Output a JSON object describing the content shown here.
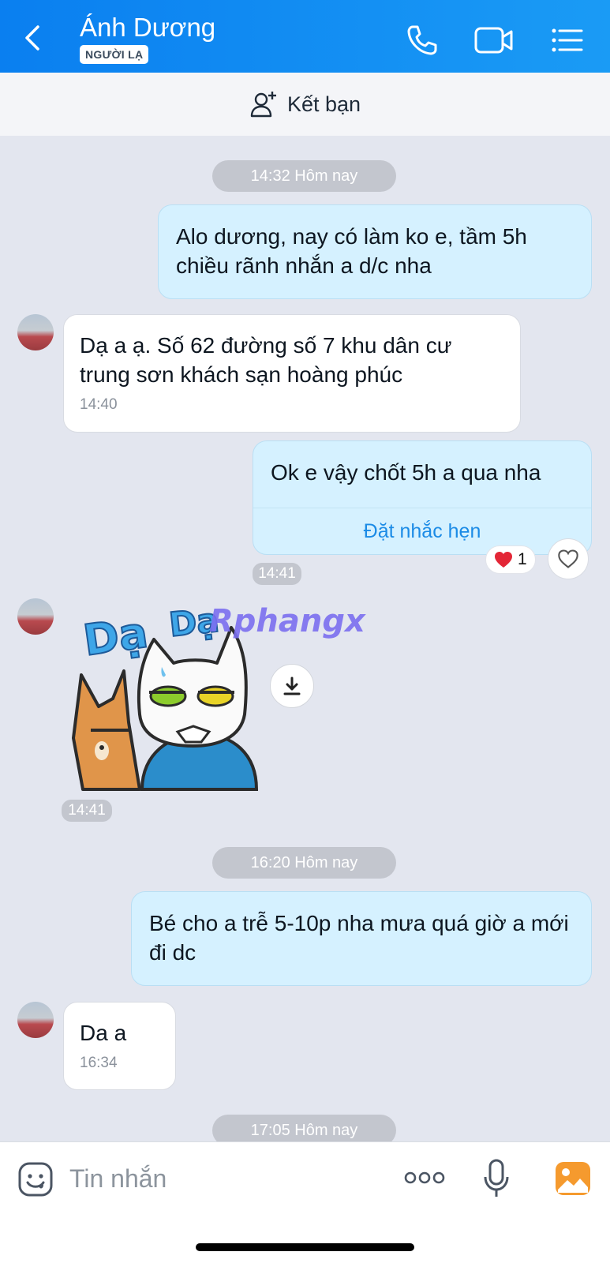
{
  "header": {
    "title": "Ánh Dương",
    "badge": "NGƯỜI LẠ",
    "bg_color": "#0a7ff0"
  },
  "friend_bar": {
    "label": "Kết bạn"
  },
  "messages": {
    "chip1": "14:32 Hôm nay",
    "m1": {
      "text": "Alo dương, nay có làm ko e, tầm 5h chiều rãnh nhắn a d/c nha"
    },
    "m2": {
      "text": "Dạ a ạ.  Số 62 đường số 7 khu dân cư trung sơn khách sạn hoàng phúc",
      "time": "14:40"
    },
    "m3": {
      "text": "Ok e vậy chốt 5h a qua nha",
      "action": "Đặt nhắc hẹn",
      "time": "14:41",
      "reaction_count": "1"
    },
    "sticker": {
      "label": "Dạ. Dạ",
      "watermark": "Rphangx",
      "time": "14:41"
    },
    "chip2": "16:20 Hôm nay",
    "m4": {
      "text": "Bé cho a trễ 5-10p nha mưa quá giờ a mới đi dc"
    },
    "m5": {
      "text": "Da a",
      "time": "16:34"
    },
    "chip3": "17:05 Hôm nay"
  },
  "composer": {
    "placeholder": "Tin nhắn"
  },
  "icons": {
    "back": "chevron-left-icon",
    "call": "phone-icon",
    "video": "video-icon",
    "menu": "list-icon",
    "add_friend": "add-user-icon",
    "emoji": "emoji-icon",
    "more": "more-icon",
    "mic": "mic-icon",
    "gallery": "image-icon",
    "download": "download-icon",
    "heart": "heart-icon"
  },
  "colors": {
    "out_bubble": "#d5f1ff",
    "in_bubble": "#ffffff",
    "accent": "#1b8be6"
  }
}
